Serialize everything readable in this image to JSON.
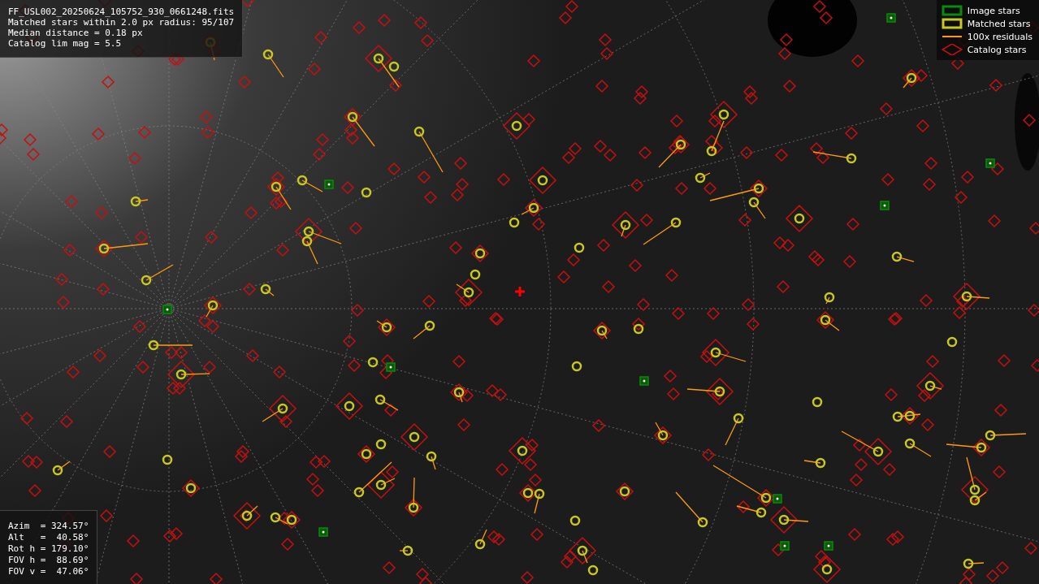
{
  "header": {
    "lines": [
      "FF_USL002_20250624_105752_930_0661248.fits",
      "Matched stars within 2.0 px radius: 95/107",
      "Median distance = 0.18 px",
      "Catalog lim mag = 5.5"
    ]
  },
  "legend": [
    {
      "kind": "image",
      "label": "Image stars",
      "color": "#0a8a0a"
    },
    {
      "kind": "matched",
      "label": "Matched stars",
      "color": "#c8c820"
    },
    {
      "kind": "residual",
      "label": "100x residuals",
      "color": "#ff9a10"
    },
    {
      "kind": "catalog",
      "label": "Catalog stars",
      "color": "#c41010"
    }
  ],
  "pointing": {
    "lines": [
      "Azim  = 324.57°",
      "Alt   =  40.58°",
      "Rot h = 179.10°",
      "FOV h =  88.69°",
      "FOV v =  47.06°"
    ]
  }
}
